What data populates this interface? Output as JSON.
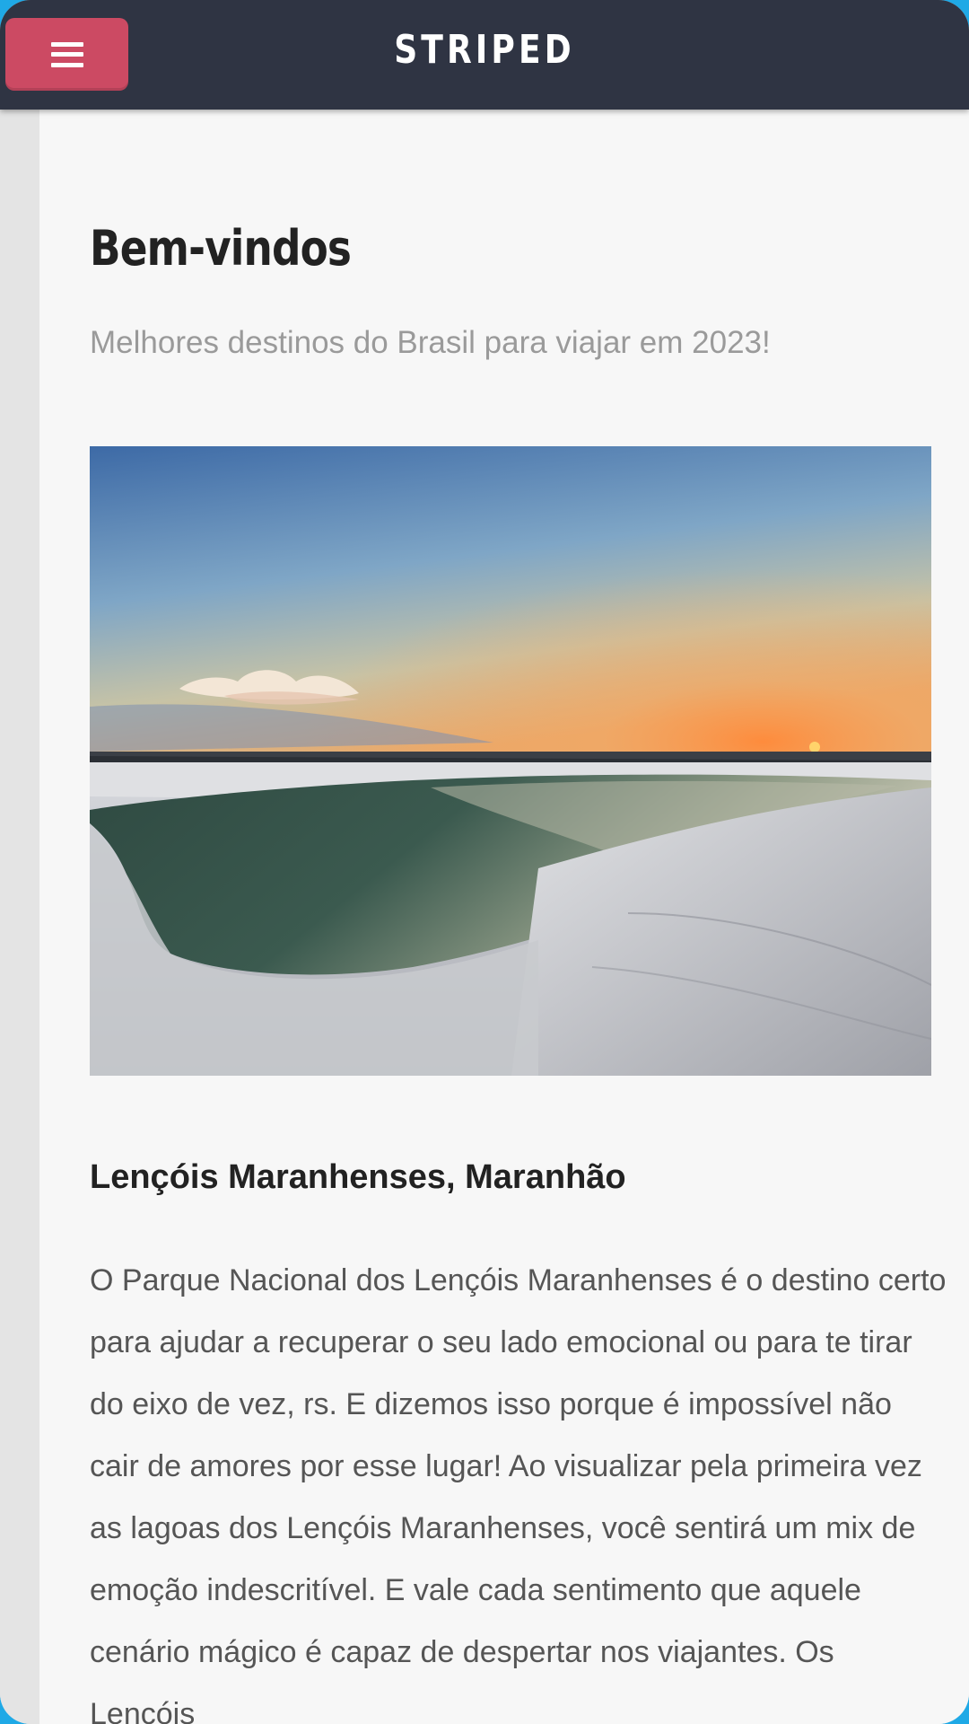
{
  "header": {
    "title": "STRIPED",
    "menu_icon": "hamburger-icon"
  },
  "main": {
    "title": "Bem-vindos",
    "subtitle": "Melhores destinos do Brasil para viajar em 2023!",
    "article": {
      "image_alt": "Lençóis Maranhenses",
      "heading": "Lençóis Maranhenses, Maranhão",
      "paragraph": "O Parque Nacional dos Lençóis Maranhenses é o destino certo para ajudar a recuperar o seu lado emocional ou para te tirar do eixo de vez, rs. E dizemos isso porque é impossível não cair de amores por esse lugar! Ao visualizar pela primeira vez as lagoas dos Lençóis Maranhenses, você sentirá um mix de emoção indescritível. E vale cada sentimento que aquele cenário mágico é capaz de despertar nos viajantes. Os Lençóis"
    }
  },
  "colors": {
    "header_bg": "#2f3443",
    "menu_button": "#cc4a63",
    "frame": "#1fa9e6"
  }
}
